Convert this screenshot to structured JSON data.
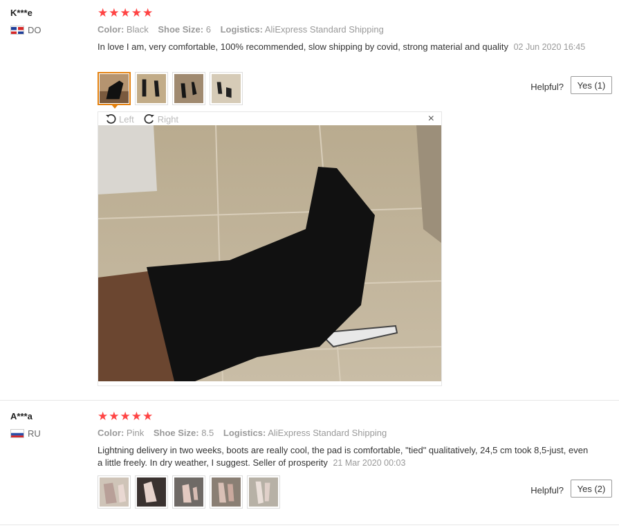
{
  "reviews": [
    {
      "user": "K***e",
      "country": "DO",
      "stars": "★★★★★",
      "color_key": "Color:",
      "color_val": "Black",
      "size_key": "Shoe Size:",
      "size_val": "6",
      "logistics_key": "Logistics:",
      "logistics_val": "AliExpress Standard Shipping",
      "text": "In love I am, very comfortable, 100% recommended, slow shipping by covid, strong material and quality",
      "date": "02 Jun 2020 16:45",
      "helpful": "Helpful?",
      "yes": "Yes (1)"
    },
    {
      "user": "A***a",
      "country": "RU",
      "stars": "★★★★★",
      "color_key": "Color:",
      "color_val": "Pink",
      "size_key": "Shoe Size:",
      "size_val": "8.5",
      "logistics_key": "Logistics:",
      "logistics_val": "AliExpress Standard Shipping",
      "text": "Lightning delivery in two weeks, boots are really cool, the pad is comfortable, \"tied\" qualitatively, 24,5 cm took 8,5-just, even a little freely. In dry weather, I suggest. Seller of prosperity",
      "date": "21 Mar 2020 00:03",
      "helpful": "Helpful?",
      "yes": "Yes (2)"
    }
  ],
  "viewer": {
    "left_label": "Left",
    "right_label": "Right",
    "close": "×"
  },
  "colors": {
    "star": "#f44444",
    "active_thumb": "#e4810f"
  }
}
